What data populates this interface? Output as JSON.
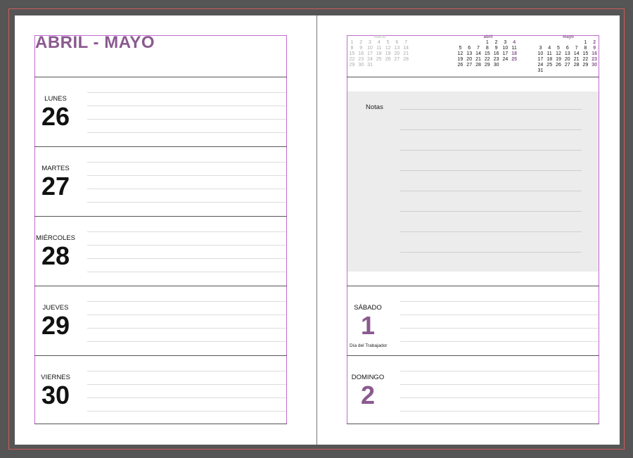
{
  "title": "ABRIL - MAYO",
  "left_days": [
    {
      "name": "LUNES",
      "number": "26"
    },
    {
      "name": "MARTES",
      "number": "27"
    },
    {
      "name": "MIÉRCOLES",
      "number": "28"
    },
    {
      "name": "JUEVES",
      "number": "29"
    },
    {
      "name": "VIERNES",
      "number": "30"
    }
  ],
  "notes_label": "Notas",
  "right_days": [
    {
      "name": "SÁBADO",
      "number": "1",
      "holiday": "Día del Trabajador"
    },
    {
      "name": "DOMINGO",
      "number": "2",
      "holiday": ""
    }
  ],
  "colors": {
    "accent": "#8a5a8f",
    "frame": "#c06ad0",
    "notes_bg": "#ececec"
  },
  "mini_calendars": [
    {
      "title": "marzo",
      "style": "grey",
      "rows": [
        [
          "1",
          "2",
          "3",
          "4",
          "5",
          "6",
          "7"
        ],
        [
          "8",
          "9",
          "10",
          "11",
          "12",
          "13",
          "14"
        ],
        [
          "15",
          "16",
          "17",
          "18",
          "19",
          "20",
          "21"
        ],
        [
          "22",
          "23",
          "24",
          "25",
          "26",
          "27",
          "28"
        ],
        [
          "29",
          "30",
          "31",
          "",
          "",
          "",
          ""
        ]
      ]
    },
    {
      "title": "abril",
      "style": "black",
      "rows": [
        [
          "",
          "",
          "",
          "1",
          "2",
          "3",
          "4"
        ],
        [
          "5",
          "6",
          "7",
          "8",
          "9",
          "10",
          "11"
        ],
        [
          "12",
          "13",
          "14",
          "15",
          "16",
          "17",
          "18"
        ],
        [
          "19",
          "20",
          "21",
          "22",
          "23",
          "24",
          "25"
        ],
        [
          "26",
          "27",
          "28",
          "29",
          "30",
          "",
          ""
        ]
      ]
    },
    {
      "title": "mayo",
      "style": "black",
      "rows": [
        [
          "",
          "",
          "",
          "",
          "",
          "1",
          "2"
        ],
        [
          "3",
          "4",
          "5",
          "6",
          "7",
          "8",
          "9"
        ],
        [
          "10",
          "11",
          "12",
          "13",
          "14",
          "15",
          "16"
        ],
        [
          "17",
          "18",
          "19",
          "20",
          "21",
          "22",
          "23"
        ],
        [
          "24",
          "25",
          "26",
          "27",
          "28",
          "29",
          "30"
        ],
        [
          "31",
          "",
          "",
          "",
          "",
          "",
          ""
        ]
      ]
    }
  ]
}
